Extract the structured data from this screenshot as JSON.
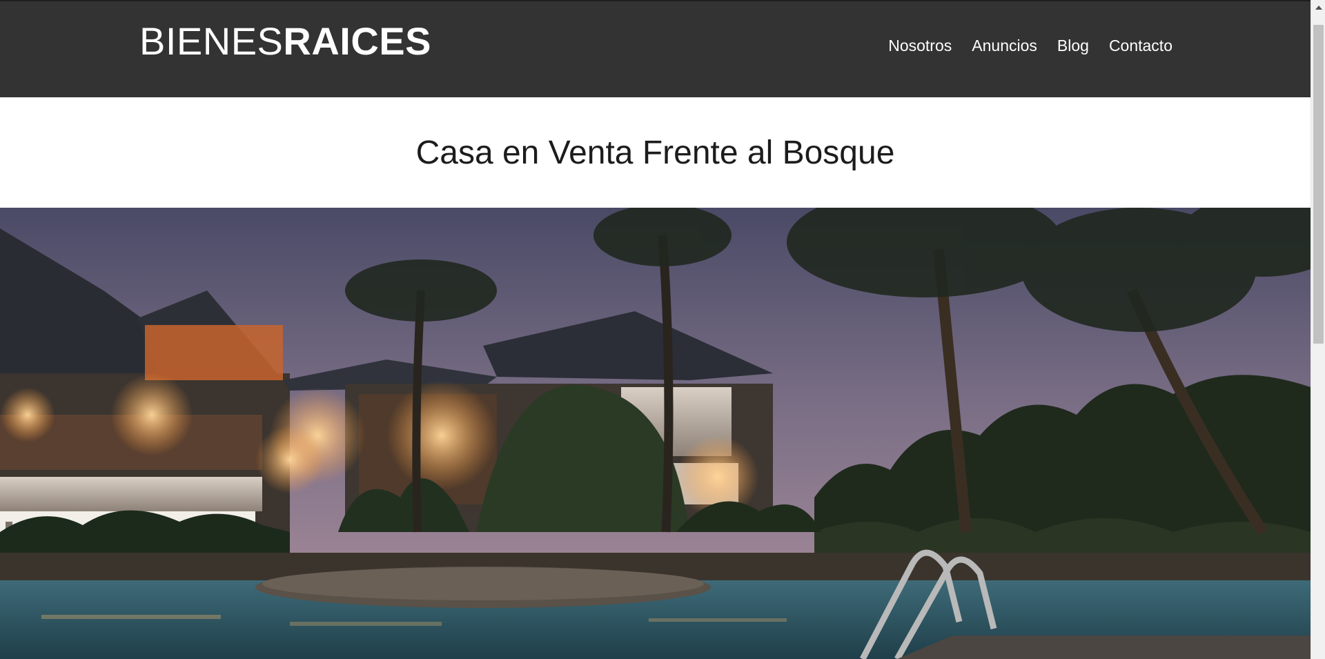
{
  "header": {
    "logo_light": "BIENES",
    "logo_bold": "RAICES",
    "nav": [
      {
        "label": "Nosotros"
      },
      {
        "label": "Anuncios"
      },
      {
        "label": "Blog"
      },
      {
        "label": "Contacto"
      }
    ],
    "background": "#333333"
  },
  "main": {
    "title": "Casa en Venta Frente al Bosque"
  },
  "colors": {
    "text_light": "#ffffff",
    "title_text": "#1c1c1c"
  }
}
